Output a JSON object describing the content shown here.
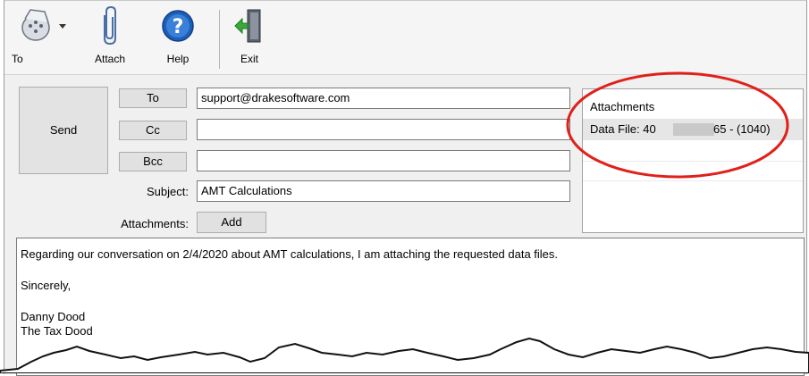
{
  "toolbar": {
    "to_label": "To",
    "attach_label": "Attach",
    "help_label": "Help",
    "exit_label": "Exit"
  },
  "compose": {
    "send_label": "Send",
    "to_button": "To",
    "cc_button": "Cc",
    "bcc_button": "Bcc",
    "to_value": "support@drakesoftware.com",
    "cc_value": "",
    "bcc_value": "",
    "subject_label": "Subject:",
    "subject_value": "AMT Calculations",
    "attachments_label": "Attachments:",
    "add_button": "Add"
  },
  "attachments_panel": {
    "header": "Attachments",
    "items": [
      {
        "prefix": "Data File: 40",
        "suffix": "65 - (1040)"
      }
    ]
  },
  "message": {
    "line1": "Regarding our conversation on 2/4/2020 about AMT calculations, I am attaching the requested data files.",
    "line2": "Sincerely,",
    "line3": "Danny Dood",
    "line4": "The Tax Dood"
  },
  "colors": {
    "highlight_circle": "#e0201b",
    "window_bg": "#f0f0f0"
  }
}
